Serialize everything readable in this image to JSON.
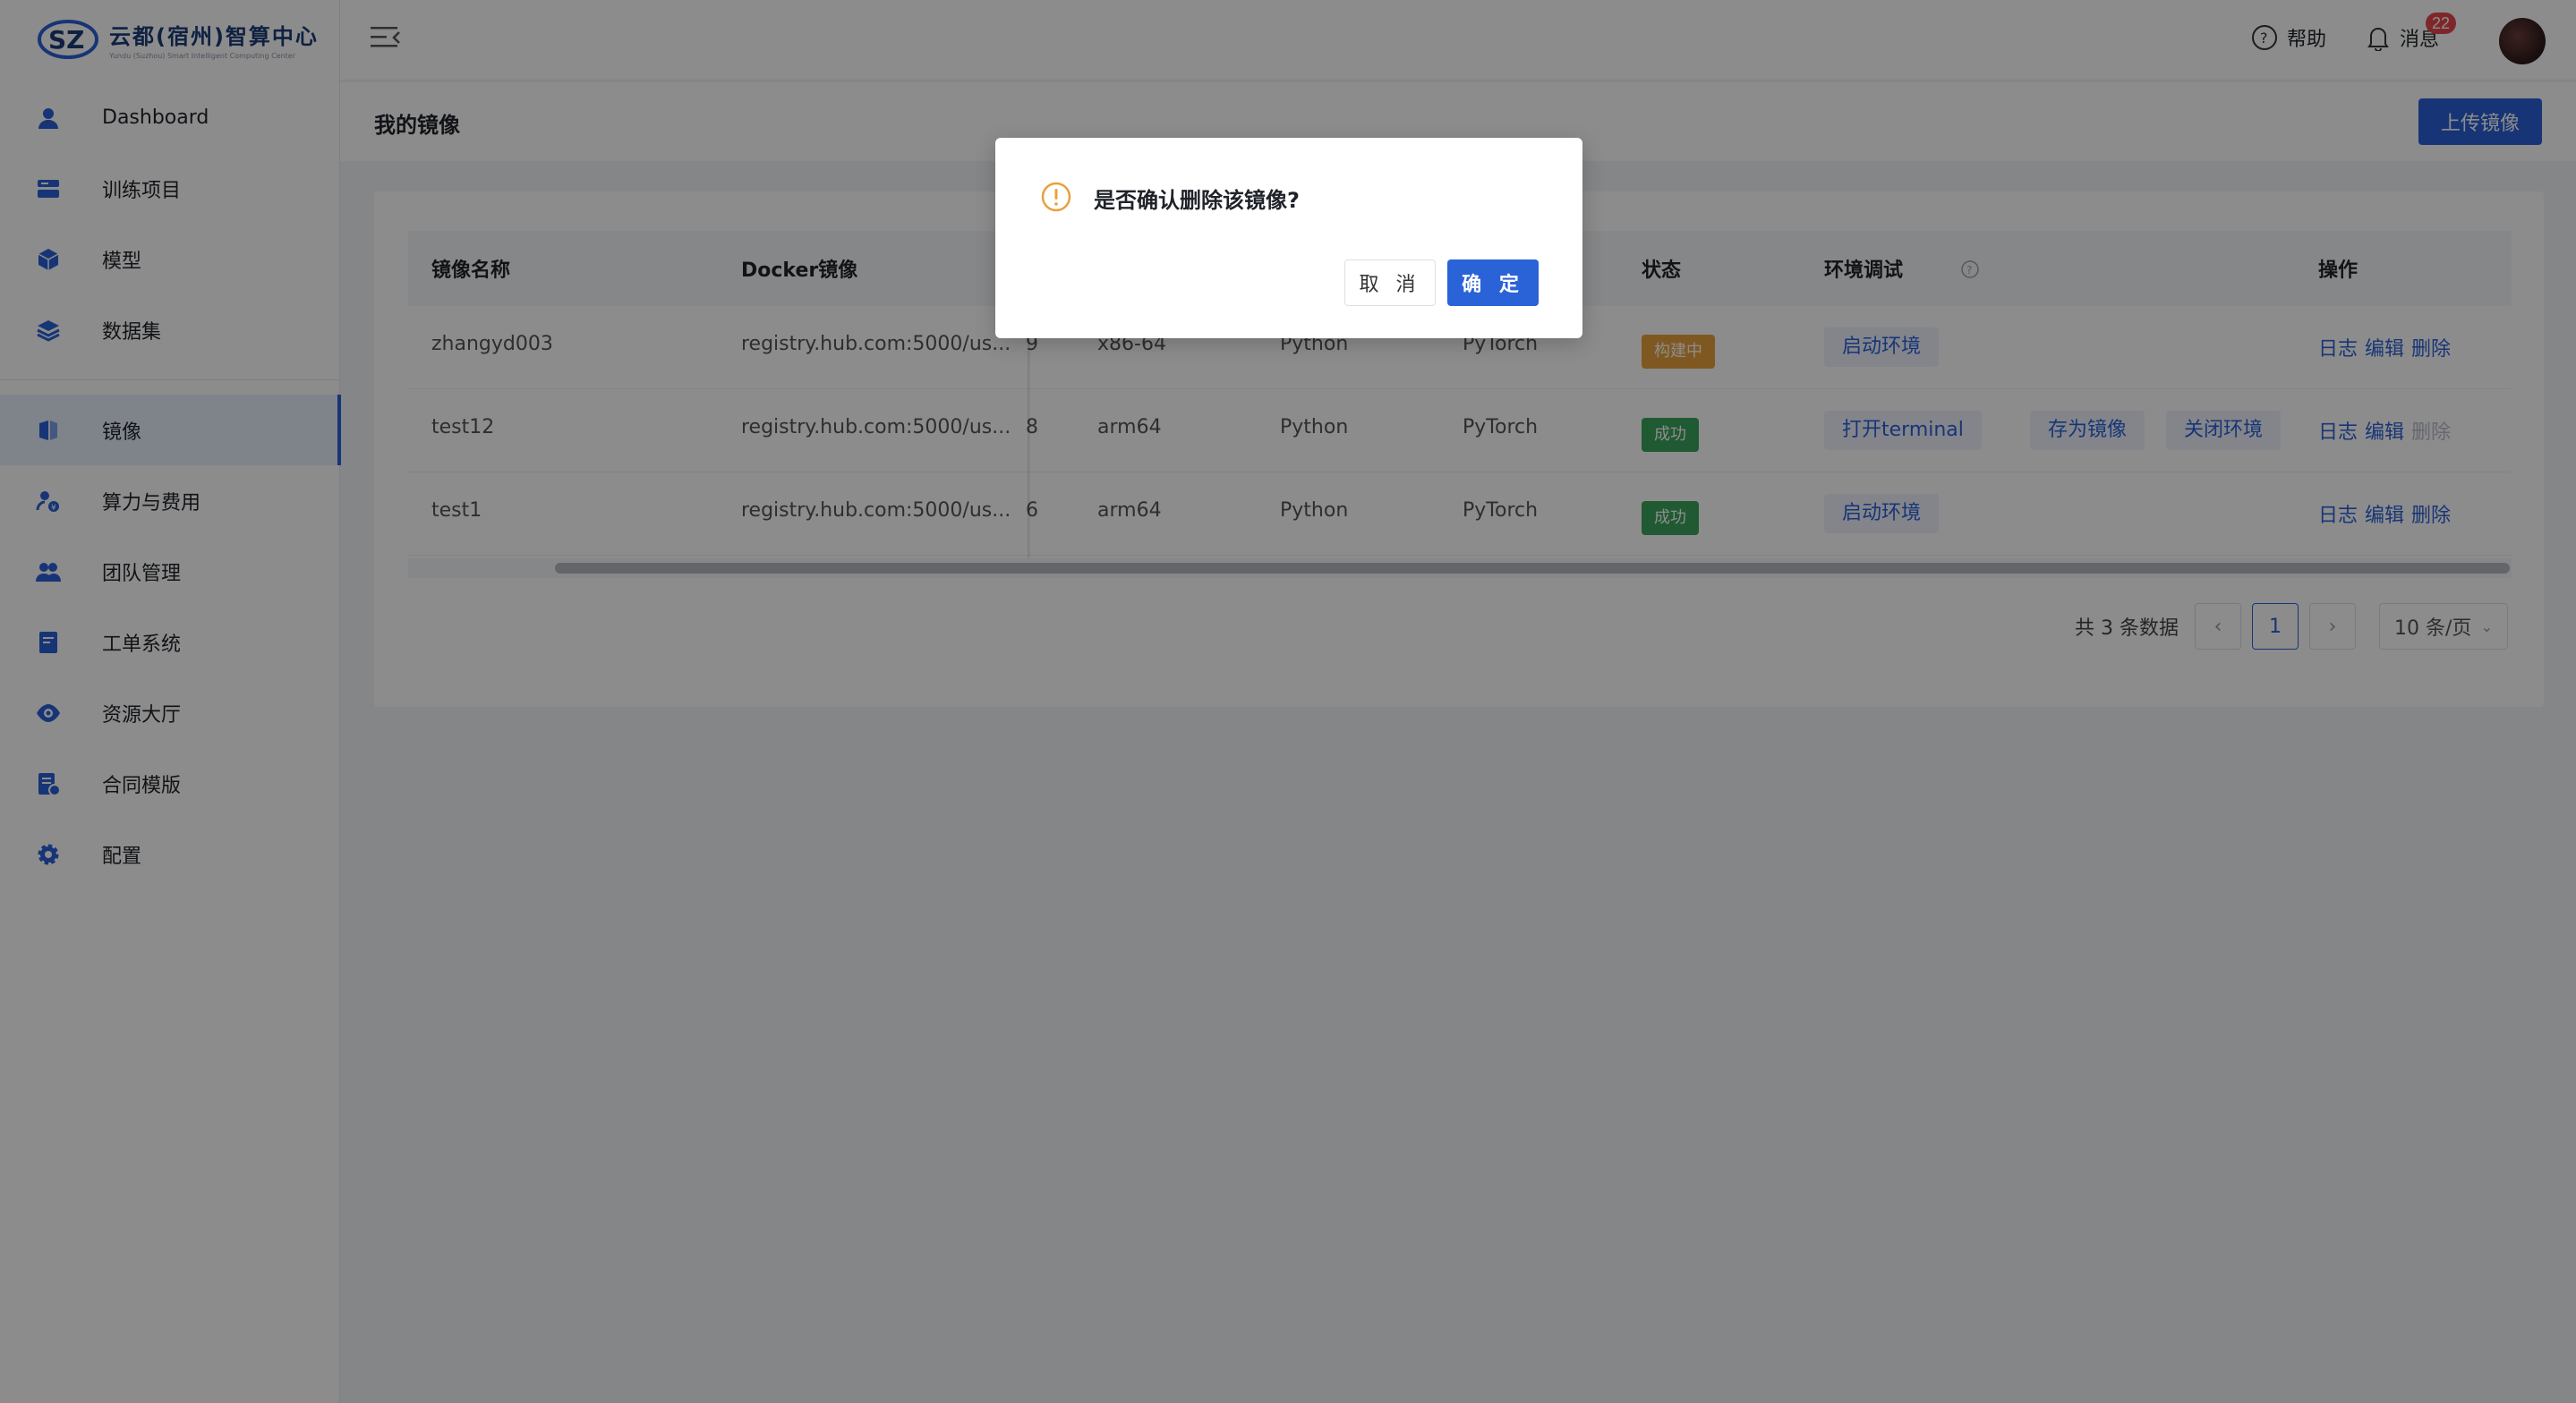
{
  "brand": {
    "title": "云都(宿州)智算中心",
    "subtitle": "Yundu (Suzhou) Smart Intelligent Computing Center"
  },
  "sidebar": {
    "items": [
      {
        "label": "Dashboard",
        "icon": "user-icon"
      },
      {
        "label": "训练项目",
        "icon": "training-icon"
      },
      {
        "label": "模型",
        "icon": "cube-icon"
      },
      {
        "label": "数据集",
        "icon": "layers-icon"
      },
      {
        "label": "镜像",
        "icon": "image-icon",
        "active": true
      },
      {
        "label": "算力与费用",
        "icon": "compute-cost-icon"
      },
      {
        "label": "团队管理",
        "icon": "team-icon"
      },
      {
        "label": "工单系统",
        "icon": "ticket-icon"
      },
      {
        "label": "资源大厅",
        "icon": "eye-icon"
      },
      {
        "label": "合同模版",
        "icon": "contract-icon"
      },
      {
        "label": "配置",
        "icon": "gear-icon"
      }
    ]
  },
  "header": {
    "help_label": "帮助",
    "messages_label": "消息",
    "messages_count": "22"
  },
  "page": {
    "title": "我的镜像",
    "upload_label": "上传镜像"
  },
  "table": {
    "columns": {
      "name": "镜像名称",
      "docker": "Docker镜像",
      "status": "状态",
      "env_debug": "环境调试",
      "actions": "操作"
    },
    "rows": [
      {
        "name": "zhangyd003",
        "docker": "registry.hub.com:5000/us...",
        "partial": "9",
        "arch": "x86-64",
        "language": "Python",
        "framework": "PyTorch",
        "status": "构建中",
        "env_actions": [
          "启动环境"
        ],
        "log": "日志",
        "edit": "编辑",
        "delete": "删除"
      },
      {
        "name": "test12",
        "docker": "registry.hub.com:5000/us...",
        "partial": "8",
        "arch": "arm64",
        "language": "Python",
        "framework": "PyTorch",
        "status": "成功",
        "env_actions": [
          "打开terminal",
          "存为镜像",
          "关闭环境"
        ],
        "log": "日志",
        "edit": "编辑",
        "delete": "删除"
      },
      {
        "name": "test1",
        "docker": "registry.hub.com:5000/us...",
        "partial": "6",
        "arch": "arm64",
        "language": "Python",
        "framework": "PyTorch",
        "status": "成功",
        "env_actions": [
          "启动环境"
        ],
        "log": "日志",
        "edit": "编辑",
        "delete": "删除"
      }
    ]
  },
  "pagination": {
    "total": "共 3 条数据",
    "current_page": "1",
    "page_size": "10 条/页"
  },
  "dialog": {
    "message": "是否确认删除该镜像?",
    "cancel_label": "取 消",
    "ok_label": "确 定"
  },
  "colors": {
    "primary": "#2a62d8",
    "warning": "#e8a13c",
    "success": "#3ba55c",
    "badge": "#e5484d"
  }
}
